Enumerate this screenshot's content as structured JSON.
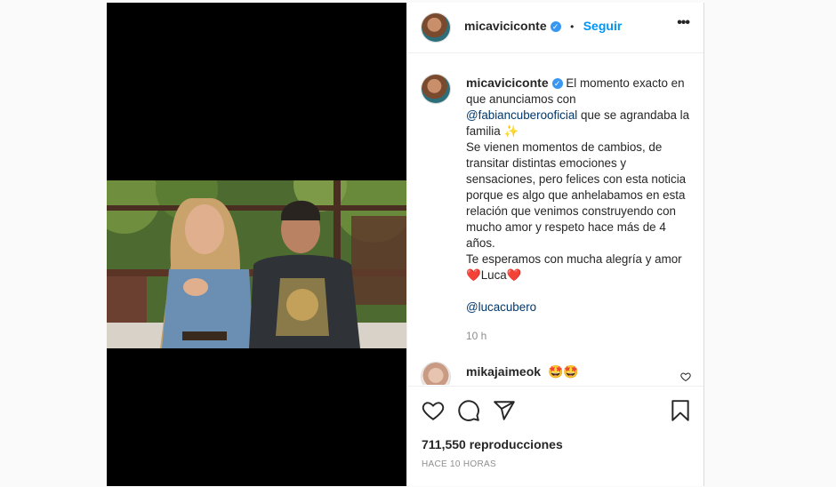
{
  "post": {
    "username": "micaviciconte",
    "follow_label": "Seguir",
    "separator": "•",
    "verified_mark": "✓",
    "more_label": "•••",
    "caption": {
      "intro": "El momento exacto en que anunciamos con",
      "mention1": "@fabiancuberooficial",
      "line1_rest": "que se agrandaba la familia",
      "sparkle": "✨",
      "body": "Se vienen momentos de cambios, de transitar distintas emociones y sensaciones, pero felices con esta noticia porque es algo que anhelabamos en esta relación que venimos construyendo con mucho amor y respeto hace más de 4 años.",
      "closing": "Te esperamos con mucha alegría y amor",
      "heart": "❤️",
      "name": "Luca",
      "mention2": "@lucacubero",
      "time": "10 h"
    },
    "comment": {
      "username": "mikajaimeok",
      "text": "🤩🤩"
    },
    "views": "711,550 reproducciones",
    "date": "HACE 10 HORAS"
  },
  "icons": {
    "like": "heart-icon",
    "comment": "comment-icon",
    "share": "share-icon",
    "save": "bookmark-icon",
    "more": "more-options-icon",
    "verified": "verified-badge-icon"
  },
  "colors": {
    "accent": "#0095f6",
    "link": "#00376b",
    "verified": "#3897f0",
    "heart": "#ed4956"
  }
}
